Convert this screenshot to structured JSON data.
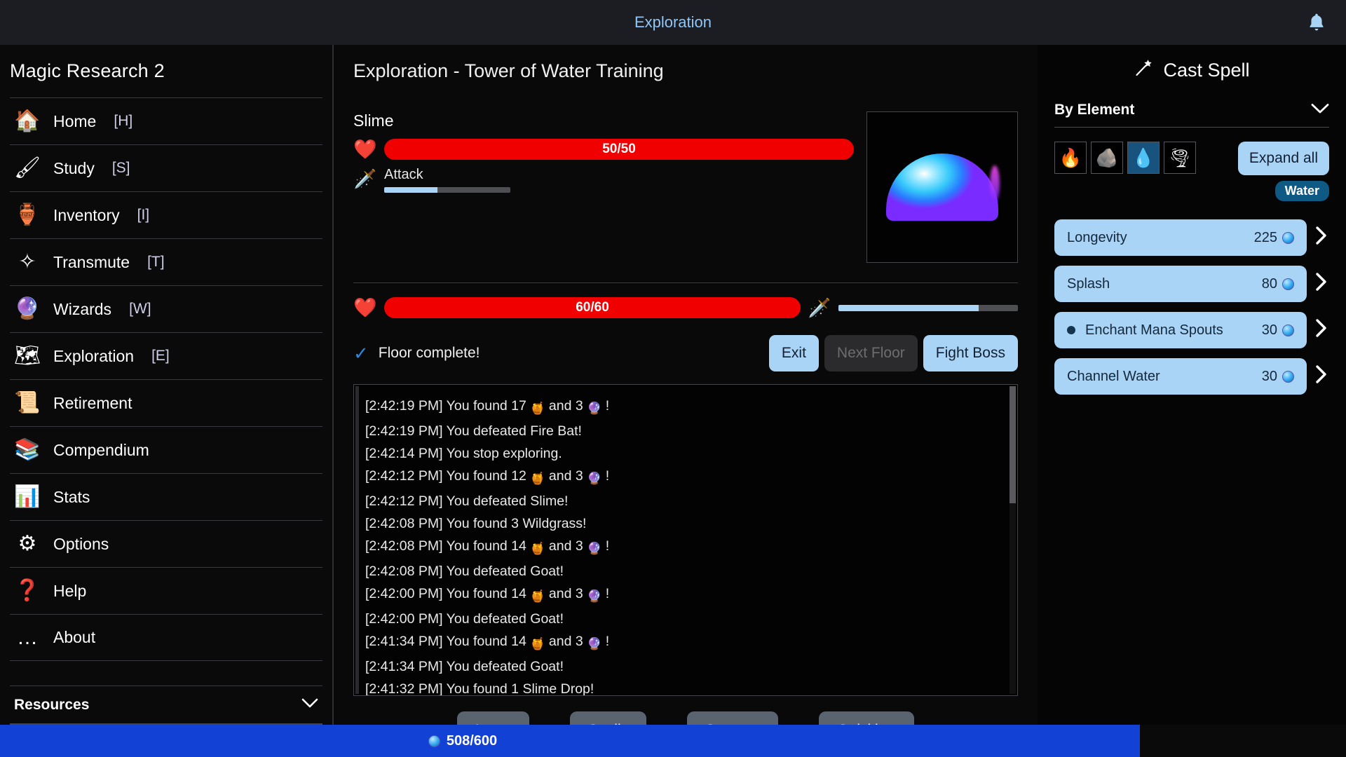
{
  "topbar": {
    "title": "Exploration",
    "bell_icon": "bell-icon"
  },
  "sidebar": {
    "title": "Magic Research 2",
    "items": [
      {
        "icon": "house-icon",
        "glyph": "🏠",
        "label": "Home",
        "key": "[H]"
      },
      {
        "icon": "quill-icon",
        "glyph": "🖌",
        "label": "Study",
        "key": "[S]"
      },
      {
        "icon": "amphora-icon",
        "glyph": "🏺",
        "label": "Inventory",
        "key": "[I]"
      },
      {
        "icon": "sparkle-icon",
        "glyph": "✧",
        "label": "Transmute",
        "key": "[T]"
      },
      {
        "icon": "wand-icon",
        "glyph": "🔮",
        "label": "Wizards",
        "key": "[W]"
      },
      {
        "icon": "map-icon",
        "glyph": "🗺",
        "label": "Exploration",
        "key": "[E]"
      },
      {
        "icon": "scroll-icon",
        "glyph": "📜",
        "label": "Retirement",
        "key": ""
      },
      {
        "icon": "books-icon",
        "glyph": "📚",
        "label": "Compendium",
        "key": ""
      },
      {
        "icon": "chart-icon",
        "glyph": "📊",
        "label": "Stats",
        "key": ""
      },
      {
        "icon": "gear-icon",
        "glyph": "⚙",
        "label": "Options",
        "key": ""
      },
      {
        "icon": "question-icon",
        "glyph": "❓",
        "label": "Help",
        "key": ""
      },
      {
        "icon": "ellipsis-icon",
        "glyph": "…",
        "label": "About",
        "key": ""
      }
    ],
    "resources_label": "Resources",
    "resources_chevron": "chevron-down-icon"
  },
  "main": {
    "title": "Exploration - Tower of Water Training",
    "enemy": {
      "name": "Slime",
      "hp_text": "50/50",
      "hp_percent": 100,
      "attack_label": "Attack",
      "attack_percent": 42,
      "portrait_icon": "slime-sprite"
    },
    "player": {
      "hp_text": "60/60",
      "hp_percent": 100,
      "attack_percent": 78
    },
    "status": {
      "check_icon": "check-icon",
      "text": "Floor complete!",
      "buttons": [
        {
          "label": "Exit",
          "disabled": false
        },
        {
          "label": "Next Floor",
          "disabled": true
        },
        {
          "label": "Fight Boss",
          "disabled": false
        }
      ]
    },
    "log": [
      {
        "time": "[2:42:19 PM]",
        "text": "You found 17 ",
        "icon1": "🍯",
        "mid": " and 3 ",
        "icon2": "🔮",
        "tail": " !"
      },
      {
        "time": "[2:42:19 PM]",
        "text": "You defeated Fire Bat!",
        "icon1": "",
        "mid": "",
        "icon2": "",
        "tail": ""
      },
      {
        "time": "[2:42:14 PM]",
        "text": "You stop exploring.",
        "icon1": "",
        "mid": "",
        "icon2": "",
        "tail": ""
      },
      {
        "time": "[2:42:12 PM]",
        "text": "You found 12 ",
        "icon1": "🍯",
        "mid": " and 3 ",
        "icon2": "🔮",
        "tail": " !"
      },
      {
        "time": "[2:42:12 PM]",
        "text": "You defeated Slime!",
        "icon1": "",
        "mid": "",
        "icon2": "",
        "tail": ""
      },
      {
        "time": "[2:42:08 PM]",
        "text": "You found 3 Wildgrass!",
        "icon1": "",
        "mid": "",
        "icon2": "",
        "tail": ""
      },
      {
        "time": "[2:42:08 PM]",
        "text": "You found 14 ",
        "icon1": "🍯",
        "mid": " and 3 ",
        "icon2": "🔮",
        "tail": " !"
      },
      {
        "time": "[2:42:08 PM]",
        "text": "You defeated Goat!",
        "icon1": "",
        "mid": "",
        "icon2": "",
        "tail": ""
      },
      {
        "time": "[2:42:00 PM]",
        "text": "You found 14 ",
        "icon1": "🍯",
        "mid": " and 3 ",
        "icon2": "🔮",
        "tail": " !"
      },
      {
        "time": "[2:42:00 PM]",
        "text": "You defeated Goat!",
        "icon1": "",
        "mid": "",
        "icon2": "",
        "tail": ""
      },
      {
        "time": "[2:41:34 PM]",
        "text": "You found 14 ",
        "icon1": "🍯",
        "mid": " and 3 ",
        "icon2": "🔮",
        "tail": " !"
      },
      {
        "time": "[2:41:34 PM]",
        "text": "You defeated Goat!",
        "icon1": "",
        "mid": "",
        "icon2": "",
        "tail": ""
      },
      {
        "time": "[2:41:32 PM]",
        "text": "You found 1 Slime Drop!",
        "icon1": "",
        "mid": "",
        "icon2": "",
        "tail": ""
      }
    ],
    "tabs": [
      {
        "label": "Items"
      },
      {
        "label": "Spells"
      },
      {
        "label": "Strategy"
      },
      {
        "label": "Quickbar"
      }
    ]
  },
  "rightpanel": {
    "wand_icon": "magic-wand-icon",
    "cast_title": "Cast Spell",
    "group_label": "By Element",
    "group_chevron": "chevron-down-icon",
    "elements": [
      {
        "name": "fire-element-icon",
        "glyph": "🔥",
        "selected": false
      },
      {
        "name": "earth-element-icon",
        "glyph": "🪨",
        "selected": false
      },
      {
        "name": "water-element-icon",
        "glyph": "💧",
        "selected": true
      },
      {
        "name": "air-element-icon",
        "glyph": "🌪",
        "selected": false
      }
    ],
    "expand_all_label": "Expand all",
    "element_badge": "Water",
    "spells": [
      {
        "name": "Longevity",
        "cost": "225",
        "dot": false
      },
      {
        "name": "Splash",
        "cost": "80",
        "dot": false
      },
      {
        "name": "Enchant Mana Spouts",
        "cost": "30",
        "dot": true
      },
      {
        "name": "Channel Water",
        "cost": "30",
        "dot": false
      }
    ]
  },
  "manabar": {
    "text": "508/600",
    "percent": 84.7,
    "orb_icon": "mana-orb-icon",
    "fill_color": "#1241d6"
  }
}
